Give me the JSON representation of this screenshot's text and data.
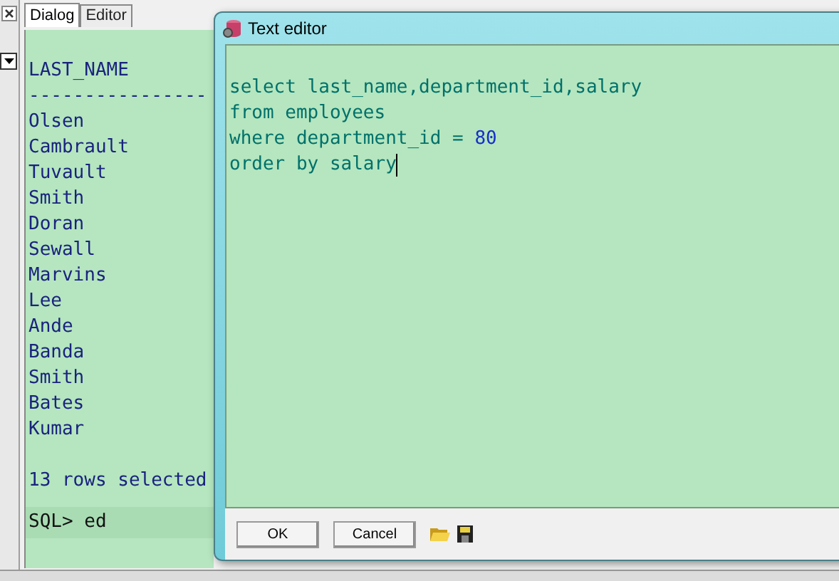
{
  "tabs": [
    {
      "label": "Dialog",
      "selected": true
    },
    {
      "label": "Editor",
      "selected": false
    }
  ],
  "output": {
    "heading": "LAST_NAME",
    "rule": "----------------",
    "rows": [
      "Olsen",
      "Cambrault",
      "Tuvault",
      "Smith",
      "Doran",
      "Sewall",
      "Marvins",
      "Lee",
      "Ande",
      "Banda",
      "Smith",
      "Bates",
      "Kumar"
    ],
    "summary": "13 rows selected",
    "prompt": "SQL> ed"
  },
  "editor_window": {
    "title": "Text editor",
    "lines": [
      [
        {
          "kind": "text",
          "text": "select last_name,department_id,salary"
        }
      ],
      [
        {
          "kind": "text",
          "text": "from employees"
        }
      ],
      [
        {
          "kind": "text",
          "text": "where department_id = "
        },
        {
          "kind": "number",
          "text": "80"
        }
      ],
      [
        {
          "kind": "text",
          "text": "order by salary"
        }
      ]
    ],
    "buttons": [
      "OK",
      "Cancel"
    ]
  }
}
